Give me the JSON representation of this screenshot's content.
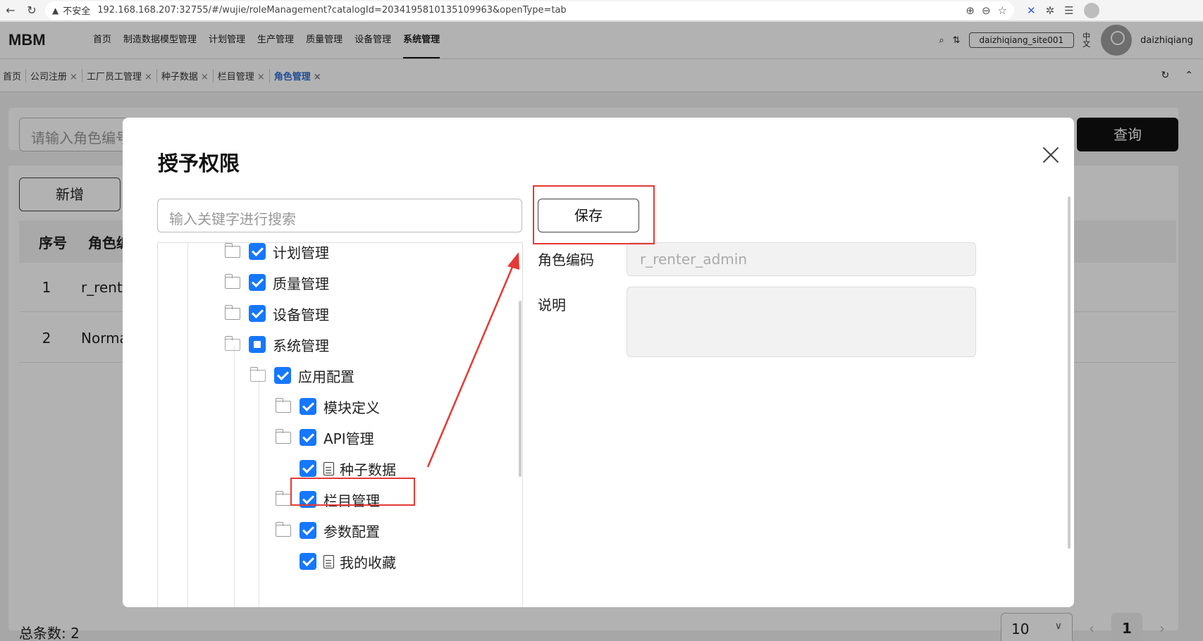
{
  "browser": {
    "back_glyph": "←",
    "reload_glyph": "↻",
    "warning_glyph": "▲",
    "insecure_label": "不安全",
    "url": "192.168.168.207:32755/#/wujie/roleManagement?catalogId=2034195810135109963&openType=tab"
  },
  "header": {
    "logo": "MBM",
    "nav": [
      "首页",
      "制造数据模型管理",
      "计划管理",
      "生产管理",
      "质量管理",
      "设备管理",
      "系统管理"
    ],
    "active_nav": "系统管理",
    "site": "daizhiqiang_site001",
    "lang": "中文",
    "username": "daizhiqiang"
  },
  "tabs": [
    {
      "label": "首页",
      "closable": false
    },
    {
      "label": "公司注册",
      "closable": true
    },
    {
      "label": "工厂员工管理",
      "closable": true
    },
    {
      "label": "种子数据",
      "closable": true
    },
    {
      "label": "栏目管理",
      "closable": true
    },
    {
      "label": "角色管理",
      "closable": true,
      "active": true
    }
  ],
  "page": {
    "search_placeholder": "请输入角色编号",
    "query_label": "查询",
    "add_label": "新增",
    "columns": [
      "序号",
      "角色编码"
    ],
    "rows": [
      {
        "index": "1",
        "code": "r_renter_admin"
      },
      {
        "index": "2",
        "code": "Normal"
      }
    ],
    "total_label": "总条数:",
    "total": "2",
    "page_size": "10",
    "current_page": "1"
  },
  "modal": {
    "title": "授予权限",
    "keyword_placeholder": "输入关键字进行搜索",
    "save_label": "保存",
    "role_code_label": "角色编码",
    "role_code_value": "r_renter_admin",
    "description_label": "说明",
    "tree": [
      {
        "label": "计划管理",
        "state": "checked",
        "level": 1,
        "icon": "folder"
      },
      {
        "label": "质量管理",
        "state": "checked",
        "level": 1,
        "icon": "folder"
      },
      {
        "label": "设备管理",
        "state": "checked",
        "level": 1,
        "icon": "folder"
      },
      {
        "label": "系统管理",
        "state": "partial",
        "level": 1,
        "icon": "folder-open"
      },
      {
        "label": "应用配置",
        "state": "checked",
        "level": 2,
        "icon": "folder-open"
      },
      {
        "label": "模块定义",
        "state": "checked",
        "level": 3,
        "icon": "folder"
      },
      {
        "label": "API管理",
        "state": "checked",
        "level": 3,
        "icon": "folder"
      },
      {
        "label": "种子数据",
        "state": "checked",
        "level": 3,
        "icon": "document"
      },
      {
        "label": "栏目管理",
        "state": "checked",
        "level": 3,
        "icon": "folder"
      },
      {
        "label": "参数配置",
        "state": "checked",
        "level": 3,
        "icon": "folder"
      },
      {
        "label": "我的收藏",
        "state": "checked",
        "level": 3,
        "icon": "document"
      }
    ]
  },
  "colors": {
    "accent": "#1677ff",
    "annotation": "#e53935",
    "primary_button": "#111111",
    "active_tab": "#2f6fd1"
  }
}
